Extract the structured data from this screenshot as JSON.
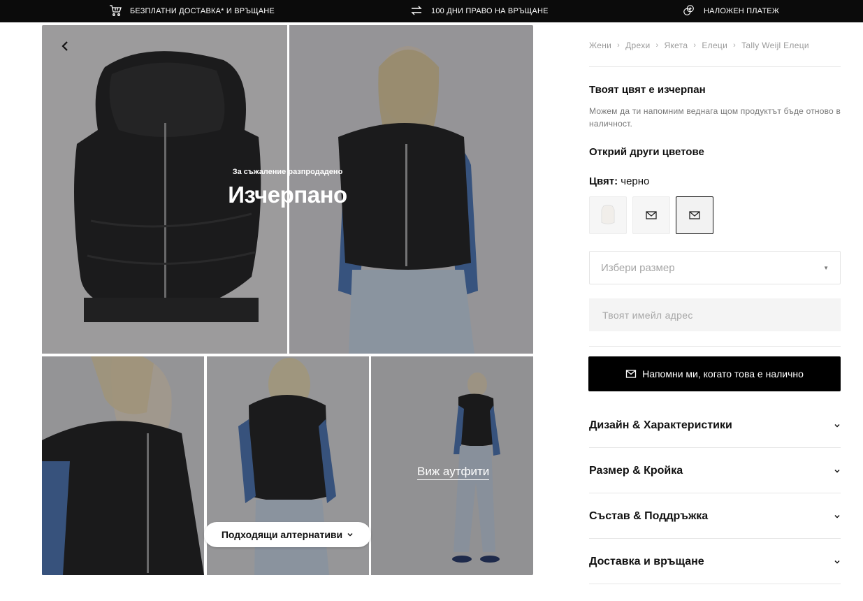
{
  "topbar": {
    "items": [
      {
        "label": "БЕЗПЛАТНИ ДОСТАВКА* И ВРЪЩАНЕ",
        "icon": "cart-icon"
      },
      {
        "label": "100 ДНИ ПРАВО НА ВРЪЩАНЕ",
        "icon": "return-arrows-icon"
      },
      {
        "label": "НАЛОЖЕН ПЛАТЕЖ",
        "icon": "coins-icon"
      }
    ]
  },
  "gallery": {
    "soldout_sub": "За съжаление разпродадено",
    "soldout_title": "Изчерпано",
    "outfits_link": "Виж аутфити",
    "alternatives_button": "Подходящи алтернативи"
  },
  "breadcrumb": [
    "Жени",
    "Дрехи",
    "Якета",
    "Елеци",
    "Tally Weijl Елеци"
  ],
  "product": {
    "oos_title": "Твоят цвят е изчерпан",
    "oos_desc": "Можем да ти напомним веднага щом продуктът бъде отново в наличност.",
    "other_colors": "Открий други цветове",
    "color_label": "Цвят:",
    "color_value": "черно",
    "size_placeholder": "Избери размер",
    "email_placeholder": "Твоят имейл адрес",
    "notify_button": "Напомни ми, когато това е налично"
  },
  "accordion": [
    {
      "label": "Дизайн & Характеристики"
    },
    {
      "label": "Размер & Кройка"
    },
    {
      "label": "Състав & Поддръжка"
    },
    {
      "label": "Доставка и връщане"
    }
  ],
  "colors": {
    "topbar_bg": "#0b0b0b",
    "button_bg": "#000000",
    "muted_text": "#9a9a9a"
  }
}
